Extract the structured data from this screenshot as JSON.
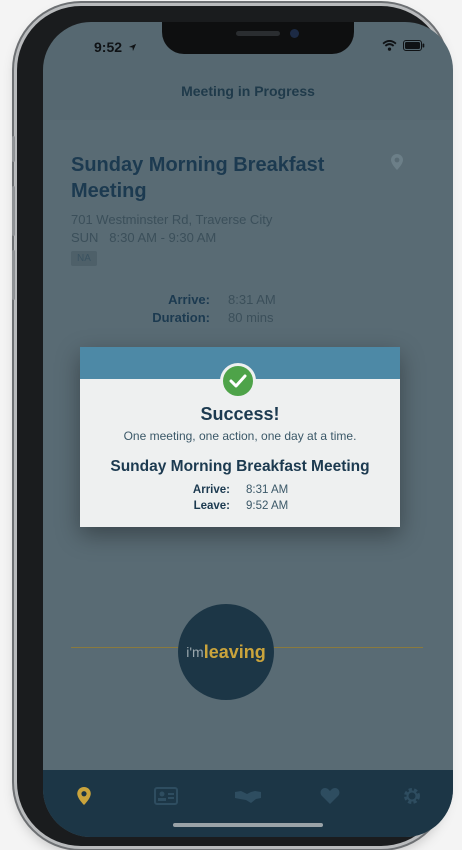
{
  "status_bar": {
    "time": "9:52"
  },
  "nav": {
    "title": "Meeting in Progress"
  },
  "meeting": {
    "title": "Sunday Morning Breakfast Meeting",
    "address": "701 Westminster Rd, Traverse City",
    "schedule": "SUN   8:30 AM - 9:30 AM",
    "badge": "NA"
  },
  "progress": {
    "arrive_label": "Arrive:",
    "arrive_value": "8:31 AM",
    "duration_label": "Duration:",
    "duration_value": "80 mins"
  },
  "dialog": {
    "title": "Success!",
    "subtitle": "One meeting, one action, one day at a time.",
    "meeting_title": "Sunday Morning Breakfast Meeting",
    "arrive_label": "Arrive:",
    "arrive_value": "8:31 AM",
    "leave_label": "Leave:",
    "leave_value": "9:52 AM"
  },
  "leave_button": {
    "prefix": "i'm",
    "label": "leaving"
  },
  "tabs": [
    {
      "icon": "map-pin-icon",
      "active": true
    },
    {
      "icon": "id-card-icon",
      "active": false
    },
    {
      "icon": "handshake-icon",
      "active": false
    },
    {
      "icon": "heart-icon",
      "active": false
    },
    {
      "icon": "gear-icon",
      "active": false
    }
  ],
  "colors": {
    "accent": "#caa43c",
    "dialog_header": "#4d89a6",
    "success": "#4ea349",
    "navy": "#1c3646"
  }
}
